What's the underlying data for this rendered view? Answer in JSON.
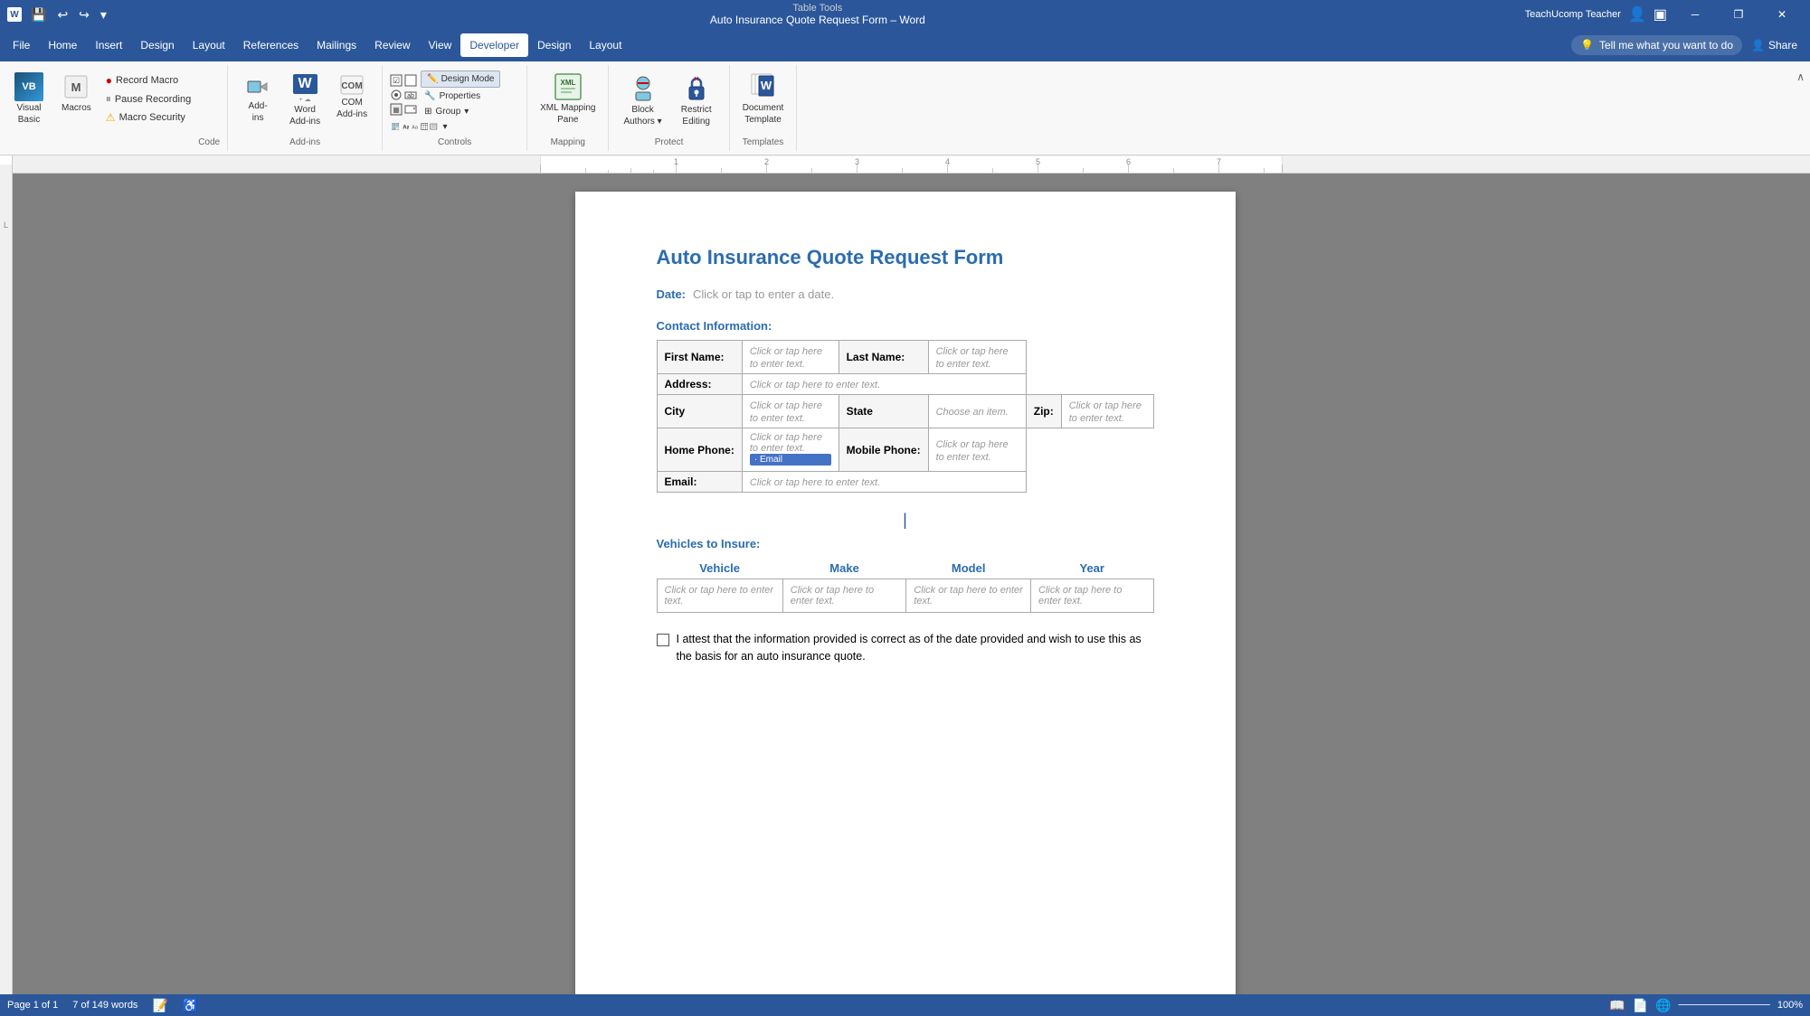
{
  "titleBar": {
    "documentTitle": "Auto Insurance Quote Request Form – Word",
    "tableTools": "Table Tools",
    "user": "TeachUcomp Teacher",
    "quickAccess": [
      "save",
      "undo",
      "redo",
      "customize"
    ],
    "windowControls": [
      "minimize",
      "restore",
      "close"
    ]
  },
  "menuBar": {
    "items": [
      "File",
      "Home",
      "Insert",
      "Design",
      "Layout",
      "References",
      "Mailings",
      "Review",
      "View",
      "Developer",
      "Design",
      "Layout"
    ],
    "activeItem": "Developer",
    "tellMe": "Tell me what you want to do",
    "share": "Share"
  },
  "ribbon": {
    "groups": [
      {
        "name": "Code",
        "items": {
          "visualBasic": "Visual Basic",
          "macros": "Macros",
          "recordMacro": "Record Macro",
          "pauseRecording": "Pause Recording",
          "macroSecurity": "Macro Security"
        }
      },
      {
        "name": "Add-ins",
        "items": {
          "addIns": "Add-ins",
          "word": "Word\nAdd-ins",
          "com": "COM\nAdd-ins"
        }
      },
      {
        "name": "Controls",
        "items": {
          "designMode": "Design Mode",
          "properties": "Properties",
          "group": "Group"
        }
      },
      {
        "name": "Mapping",
        "items": {
          "xmlMappingPane": "XML Mapping\nPane"
        }
      },
      {
        "name": "Protect",
        "items": {
          "blockAuthors": "Block\nAuthors",
          "restrictEditing": "Restrict\nEditing"
        }
      },
      {
        "name": "Templates",
        "items": {
          "documentTemplate": "Document\nTemplate"
        }
      }
    ]
  },
  "document": {
    "title": "Auto Insurance Quote Request Form",
    "dateLabel": "Date:",
    "datePlaceholder": "Click or tap to enter a date.",
    "contactTitle": "Contact Information:",
    "contactTable": {
      "rows": [
        [
          {
            "label": "First Name:",
            "isLabel": true
          },
          {
            "value": "Click or tap here to enter text.",
            "isLabel": false
          },
          {
            "label": "Last Name:",
            "isLabel": true
          },
          {
            "value": "Click or tap here to enter text.",
            "isLabel": false
          }
        ],
        [
          {
            "label": "Address:",
            "isLabel": true
          },
          {
            "value": "Click or tap here to enter text.",
            "isLabel": false,
            "colspan": 3
          }
        ],
        [
          {
            "label": "City",
            "isLabel": true
          },
          {
            "value": "Click or tap here to enter text.",
            "isLabel": false
          },
          {
            "label": "State",
            "isLabel": true
          },
          {
            "value": "Choose an item.",
            "isLabel": false
          },
          {
            "label": "Zip:",
            "isLabel": true
          },
          {
            "value": "Click or tap here to enter text.",
            "isLabel": false
          }
        ],
        [
          {
            "label": "Home Phone:",
            "isLabel": true
          },
          {
            "value": "Click or tap here to enter text.",
            "isLabel": false
          },
          {
            "label": "Mobile Phone:",
            "isLabel": true
          },
          {
            "value": "Click or tap here to enter text.",
            "isLabel": false
          }
        ],
        [
          {
            "label": "Email:",
            "isLabel": true
          },
          {
            "value": "Click or tap here to enter text.",
            "isLabel": false,
            "colspan": 3
          }
        ]
      ]
    },
    "vehiclesTitle": "Vehicles to Insure:",
    "vehiclesHeaders": [
      "Vehicle",
      "Make",
      "Model",
      "Year"
    ],
    "vehiclesRow": [
      "Click or tap here to enter text.",
      "Click or tap here to enter text.",
      "Click or tap here to enter text.",
      "Click or tap here to enter text."
    ],
    "attestation": "I attest that the information provided is correct as of the date provided and wish to use this as the basis for an auto insurance quote."
  },
  "statusBar": {
    "page": "Page 1 of 1",
    "words": "7 of 149 words",
    "zoom": "100%"
  }
}
